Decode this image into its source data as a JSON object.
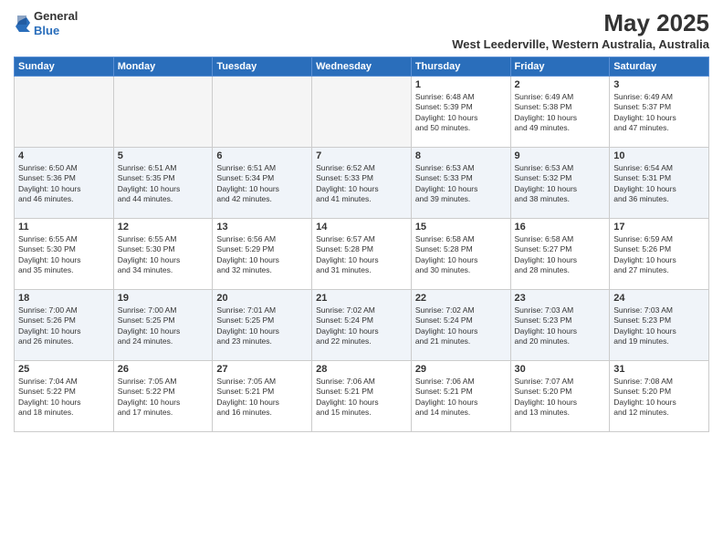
{
  "header": {
    "logo_line1": "General",
    "logo_line2": "Blue",
    "title": "May 2025",
    "subtitle": "West Leederville, Western Australia, Australia"
  },
  "weekdays": [
    "Sunday",
    "Monday",
    "Tuesday",
    "Wednesday",
    "Thursday",
    "Friday",
    "Saturday"
  ],
  "weeks": [
    [
      {
        "day": "",
        "info": ""
      },
      {
        "day": "",
        "info": ""
      },
      {
        "day": "",
        "info": ""
      },
      {
        "day": "",
        "info": ""
      },
      {
        "day": "1",
        "info": "Sunrise: 6:48 AM\nSunset: 5:39 PM\nDaylight: 10 hours\nand 50 minutes."
      },
      {
        "day": "2",
        "info": "Sunrise: 6:49 AM\nSunset: 5:38 PM\nDaylight: 10 hours\nand 49 minutes."
      },
      {
        "day": "3",
        "info": "Sunrise: 6:49 AM\nSunset: 5:37 PM\nDaylight: 10 hours\nand 47 minutes."
      }
    ],
    [
      {
        "day": "4",
        "info": "Sunrise: 6:50 AM\nSunset: 5:36 PM\nDaylight: 10 hours\nand 46 minutes."
      },
      {
        "day": "5",
        "info": "Sunrise: 6:51 AM\nSunset: 5:35 PM\nDaylight: 10 hours\nand 44 minutes."
      },
      {
        "day": "6",
        "info": "Sunrise: 6:51 AM\nSunset: 5:34 PM\nDaylight: 10 hours\nand 42 minutes."
      },
      {
        "day": "7",
        "info": "Sunrise: 6:52 AM\nSunset: 5:33 PM\nDaylight: 10 hours\nand 41 minutes."
      },
      {
        "day": "8",
        "info": "Sunrise: 6:53 AM\nSunset: 5:33 PM\nDaylight: 10 hours\nand 39 minutes."
      },
      {
        "day": "9",
        "info": "Sunrise: 6:53 AM\nSunset: 5:32 PM\nDaylight: 10 hours\nand 38 minutes."
      },
      {
        "day": "10",
        "info": "Sunrise: 6:54 AM\nSunset: 5:31 PM\nDaylight: 10 hours\nand 36 minutes."
      }
    ],
    [
      {
        "day": "11",
        "info": "Sunrise: 6:55 AM\nSunset: 5:30 PM\nDaylight: 10 hours\nand 35 minutes."
      },
      {
        "day": "12",
        "info": "Sunrise: 6:55 AM\nSunset: 5:30 PM\nDaylight: 10 hours\nand 34 minutes."
      },
      {
        "day": "13",
        "info": "Sunrise: 6:56 AM\nSunset: 5:29 PM\nDaylight: 10 hours\nand 32 minutes."
      },
      {
        "day": "14",
        "info": "Sunrise: 6:57 AM\nSunset: 5:28 PM\nDaylight: 10 hours\nand 31 minutes."
      },
      {
        "day": "15",
        "info": "Sunrise: 6:58 AM\nSunset: 5:28 PM\nDaylight: 10 hours\nand 30 minutes."
      },
      {
        "day": "16",
        "info": "Sunrise: 6:58 AM\nSunset: 5:27 PM\nDaylight: 10 hours\nand 28 minutes."
      },
      {
        "day": "17",
        "info": "Sunrise: 6:59 AM\nSunset: 5:26 PM\nDaylight: 10 hours\nand 27 minutes."
      }
    ],
    [
      {
        "day": "18",
        "info": "Sunrise: 7:00 AM\nSunset: 5:26 PM\nDaylight: 10 hours\nand 26 minutes."
      },
      {
        "day": "19",
        "info": "Sunrise: 7:00 AM\nSunset: 5:25 PM\nDaylight: 10 hours\nand 24 minutes."
      },
      {
        "day": "20",
        "info": "Sunrise: 7:01 AM\nSunset: 5:25 PM\nDaylight: 10 hours\nand 23 minutes."
      },
      {
        "day": "21",
        "info": "Sunrise: 7:02 AM\nSunset: 5:24 PM\nDaylight: 10 hours\nand 22 minutes."
      },
      {
        "day": "22",
        "info": "Sunrise: 7:02 AM\nSunset: 5:24 PM\nDaylight: 10 hours\nand 21 minutes."
      },
      {
        "day": "23",
        "info": "Sunrise: 7:03 AM\nSunset: 5:23 PM\nDaylight: 10 hours\nand 20 minutes."
      },
      {
        "day": "24",
        "info": "Sunrise: 7:03 AM\nSunset: 5:23 PM\nDaylight: 10 hours\nand 19 minutes."
      }
    ],
    [
      {
        "day": "25",
        "info": "Sunrise: 7:04 AM\nSunset: 5:22 PM\nDaylight: 10 hours\nand 18 minutes."
      },
      {
        "day": "26",
        "info": "Sunrise: 7:05 AM\nSunset: 5:22 PM\nDaylight: 10 hours\nand 17 minutes."
      },
      {
        "day": "27",
        "info": "Sunrise: 7:05 AM\nSunset: 5:21 PM\nDaylight: 10 hours\nand 16 minutes."
      },
      {
        "day": "28",
        "info": "Sunrise: 7:06 AM\nSunset: 5:21 PM\nDaylight: 10 hours\nand 15 minutes."
      },
      {
        "day": "29",
        "info": "Sunrise: 7:06 AM\nSunset: 5:21 PM\nDaylight: 10 hours\nand 14 minutes."
      },
      {
        "day": "30",
        "info": "Sunrise: 7:07 AM\nSunset: 5:20 PM\nDaylight: 10 hours\nand 13 minutes."
      },
      {
        "day": "31",
        "info": "Sunrise: 7:08 AM\nSunset: 5:20 PM\nDaylight: 10 hours\nand 12 minutes."
      }
    ]
  ]
}
